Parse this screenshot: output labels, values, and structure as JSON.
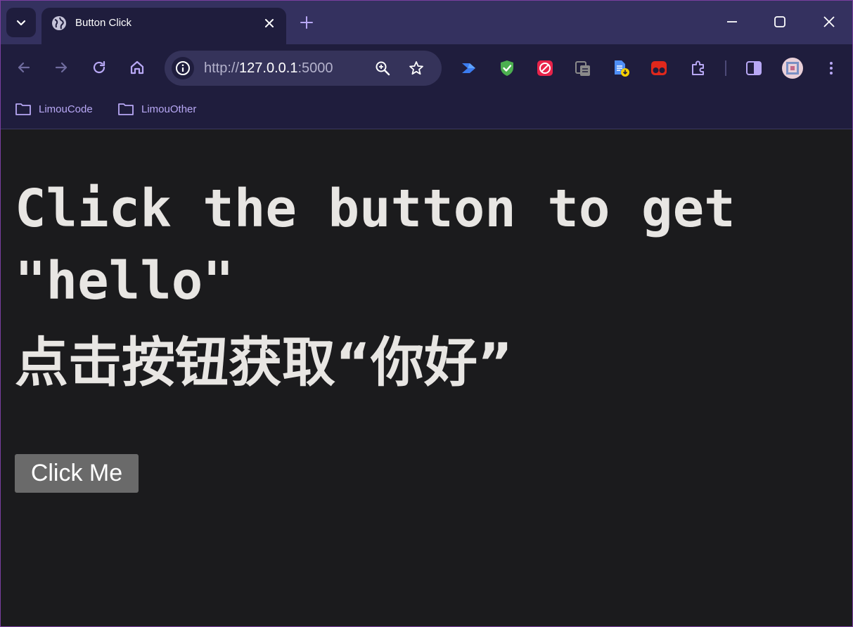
{
  "browser": {
    "tab": {
      "title": "Button Click"
    },
    "address_bar": {
      "scheme": "http://",
      "host": "127.0.0.1",
      "port": ":5000"
    },
    "bookmarks": [
      {
        "label": "LimouCode",
        "icon": "folder-icon"
      },
      {
        "label": "LimouOther",
        "icon": "folder-icon"
      }
    ],
    "colors": {
      "tabstrip": "#34315f",
      "toolbar": "#1f1d3d",
      "accent": "#b8a8f5"
    }
  },
  "page": {
    "heading_en": "Click the button to get \"hello\"",
    "heading_zh": "点击按钮获取“你好”",
    "button_label": "Click Me",
    "colors": {
      "background": "#1b1b1d",
      "text": "#e8e6e3",
      "button": "#6a6a6a"
    }
  }
}
